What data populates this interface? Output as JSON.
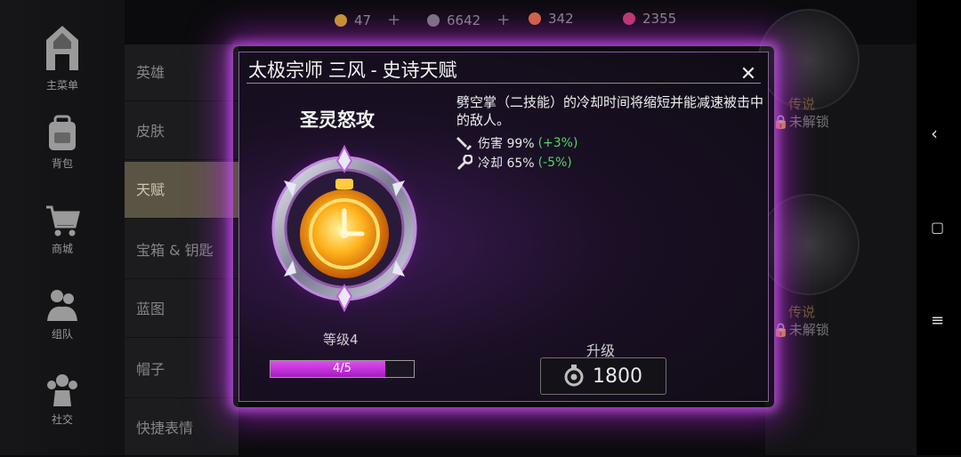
{
  "topbar": {
    "resources": [
      {
        "icon": "gold-coin-icon",
        "value": "47",
        "has_plus": true,
        "color": "#c8a020"
      },
      {
        "icon": "gear-token-icon",
        "value": "6642",
        "has_plus": true,
        "color": "#9a9a9a"
      },
      {
        "icon": "rainbow-gem-icon",
        "value": "342",
        "has_plus": false,
        "color": "#d46a3a"
      },
      {
        "icon": "red-crystal-icon",
        "value": "2355",
        "has_plus": false,
        "color": "#c03a6a"
      }
    ]
  },
  "leftnav": [
    {
      "label": "主菜单",
      "icon": "main-menu-icon"
    },
    {
      "label": "背包",
      "icon": "backpack-icon"
    },
    {
      "label": "商城",
      "icon": "shop-cart-icon"
    },
    {
      "label": "组队",
      "icon": "team-icon"
    },
    {
      "label": "社交",
      "icon": "social-icon"
    }
  ],
  "categories": [
    "英雄",
    "皮肤",
    "天赋",
    "宝箱 & 钥匙",
    "蓝图",
    "帽子",
    "快捷表情"
  ],
  "active_category": "天赋",
  "background_cards": [
    {
      "rarity": "传说",
      "status": "未解锁"
    },
    {
      "rarity": "传说",
      "status": "未解锁"
    }
  ],
  "modal": {
    "title": "太极宗师 三风 - 史诗天赋",
    "talent_name": "圣灵怒攻",
    "description": "劈空掌（二技能）的冷却时间将缩短并能减速被击中的敌人。",
    "stats": [
      {
        "icon": "dagger-icon",
        "label": "伤害 99%",
        "delta": "(+3%)"
      },
      {
        "icon": "wrench-icon",
        "label": "冷却 65%",
        "delta": "(-5%)"
      }
    ],
    "level_label": "等级4",
    "progress": {
      "text": "4/5",
      "current": 4,
      "max": 5
    },
    "upgrade_label": "升级",
    "upgrade_cost": "1800",
    "close_symbol": "✕"
  },
  "colors": {
    "accent_glow": "#b428dc",
    "stat_delta": "#4fd865",
    "progress_fill": "#d23ee6"
  }
}
